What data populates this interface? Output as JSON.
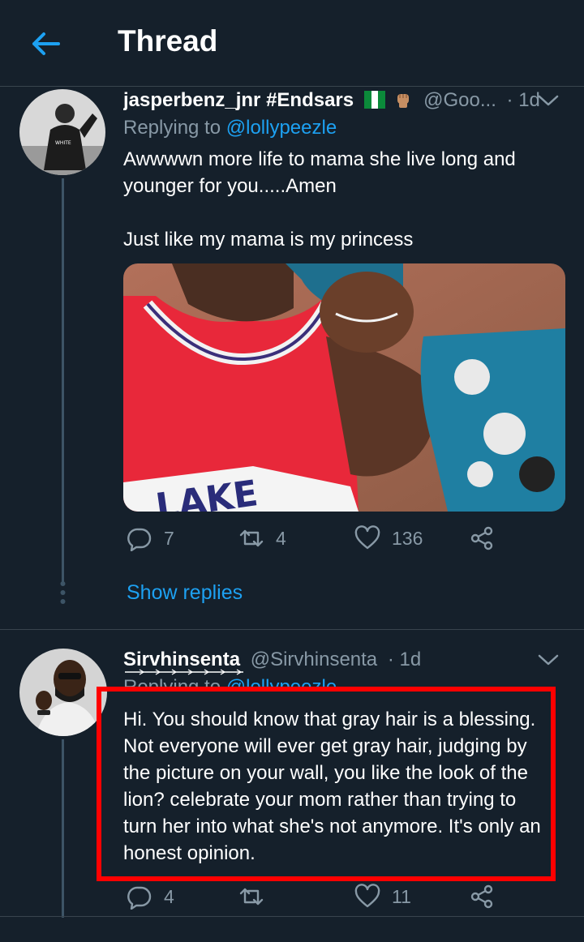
{
  "header": {
    "title": "Thread"
  },
  "tweets": [
    {
      "display_name": "jasperbenz_jnr #Endsars",
      "handle": "@Goo...",
      "time": "· 1d",
      "replying_prefix": "Replying to",
      "replying_to": "@lollypeezle",
      "text": "Awwwwn more life to mama she live long and\nyounger for you.....Amen\n\nJust like my mama is my princess",
      "counts": {
        "replies": "7",
        "retweets": "4",
        "likes": "136"
      },
      "show_replies": "Show replies"
    },
    {
      "display_name": "Sirvhinsenta",
      "handle": "@Sirvhinsenta",
      "time": "· 1d",
      "replying_prefix": "Replying to",
      "replying_to": "@lollypeezle",
      "text": "Hi. You should know that gray hair is a blessing.\nNot everyone will ever get gray hair, judging by\nthe picture on your wall, you like the look of the\nlion? celebrate your mom rather than trying to\nturn her into what she's not anymore. It's only an\nhonest opinion.",
      "counts": {
        "replies": "4",
        "retweets": "",
        "likes": "11"
      }
    }
  ],
  "icons": {
    "back": "back-arrow-icon",
    "caret": "chevron-down-icon",
    "reply": "reply-icon",
    "retweet": "retweet-icon",
    "like": "heart-icon",
    "share": "share-icon"
  },
  "colors": {
    "background": "#15202b",
    "accent": "#1da1f2",
    "muted": "#8899a6",
    "highlight_box": "#ff0000"
  }
}
